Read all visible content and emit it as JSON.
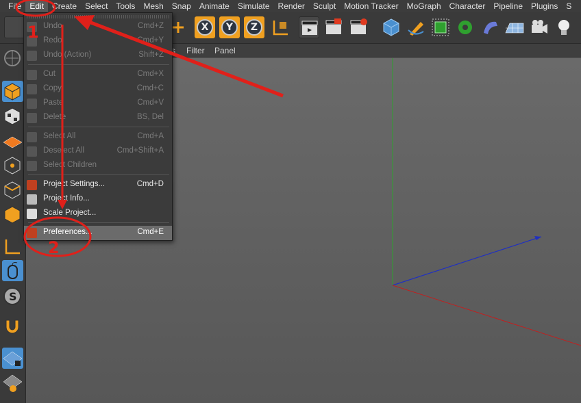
{
  "menubar": {
    "items": [
      "File",
      "Edit",
      "Create",
      "Select",
      "Tools",
      "Mesh",
      "Snap",
      "Animate",
      "Simulate",
      "Render",
      "Sculpt",
      "Motion Tracker",
      "MoGraph",
      "Character",
      "Pipeline",
      "Plugins",
      "S"
    ],
    "active_index": 1
  },
  "axis_buttons": [
    "X",
    "Y",
    "Z"
  ],
  "subheader": {
    "filter": "Filter",
    "panel": "Panel",
    "fragment": "s"
  },
  "edit_menu": {
    "items": [
      {
        "label": "Undo",
        "shortcut": "Cmd+Z",
        "enabled": false,
        "icon": "undo-icon"
      },
      {
        "label": "Redo",
        "shortcut": "Cmd+Y",
        "enabled": false,
        "icon": "redo-icon"
      },
      {
        "label": "Undo (Action)",
        "shortcut": "Shift+Z",
        "enabled": false,
        "icon": "undo-action-icon"
      },
      {
        "label": "Cut",
        "shortcut": "Cmd+X",
        "enabled": false,
        "icon": "cut-icon"
      },
      {
        "label": "Copy",
        "shortcut": "Cmd+C",
        "enabled": false,
        "icon": "copy-icon"
      },
      {
        "label": "Paste",
        "shortcut": "Cmd+V",
        "enabled": false,
        "icon": "paste-icon"
      },
      {
        "label": "Delete",
        "shortcut": "BS, Del",
        "enabled": false,
        "icon": "delete-icon"
      },
      {
        "label": "Select All",
        "shortcut": "Cmd+A",
        "enabled": false,
        "icon": "select-all-icon"
      },
      {
        "label": "Deselect All",
        "shortcut": "Cmd+Shift+A",
        "enabled": false,
        "icon": "deselect-all-icon"
      },
      {
        "label": "Select Children",
        "shortcut": "",
        "enabled": false,
        "icon": "select-children-icon"
      },
      {
        "label": "Project Settings...",
        "shortcut": "Cmd+D",
        "enabled": true,
        "icon": "project-settings-icon"
      },
      {
        "label": "Project Info...",
        "shortcut": "",
        "enabled": true,
        "icon": "project-info-icon"
      },
      {
        "label": "Scale Project...",
        "shortcut": "",
        "enabled": true,
        "icon": "scale-project-icon"
      },
      {
        "label": "Preferences...",
        "shortcut": "Cmd+E",
        "enabled": true,
        "highlighted": true,
        "icon": "preferences-icon"
      }
    ]
  },
  "annotations": {
    "step1": "1",
    "step2": "2"
  },
  "colors": {
    "accent_orange": "#f0a020",
    "annotation_red": "#e0201a",
    "tool_blue": "#4a90d0",
    "axis_green": "#2fa02f",
    "axis_blue": "#2030c0",
    "axis_red": "#c02020"
  }
}
